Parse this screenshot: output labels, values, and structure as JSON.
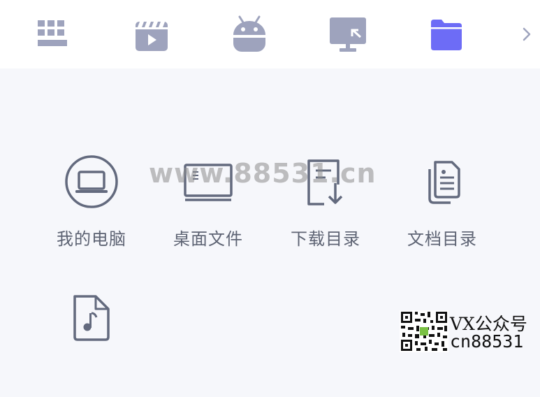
{
  "tabs": [
    {
      "icon": "apps-grid-icon",
      "active": false
    },
    {
      "icon": "video-clapper-icon",
      "active": false
    },
    {
      "icon": "android-icon",
      "active": false
    },
    {
      "icon": "screen-cast-icon",
      "active": false
    },
    {
      "icon": "folder-icon",
      "active": true
    }
  ],
  "more_icon": "chevron-right-icon",
  "colors": {
    "inactive_icon": "#9ea3bd",
    "active_icon": "#6d6cf6",
    "label": "#5d6373",
    "item_icon": "#636a7e",
    "background": "#f6f7fb"
  },
  "items": [
    {
      "label": "我的电脑",
      "icon": "laptop-icon"
    },
    {
      "label": "桌面文件",
      "icon": "desktop-monitor-icon"
    },
    {
      "label": "下载目录",
      "icon": "download-document-icon"
    },
    {
      "label": "文档目录",
      "icon": "documents-icon"
    },
    {
      "label": "",
      "icon": "music-file-icon"
    }
  ],
  "watermark": "www.88531.cn",
  "badge": {
    "line1": "VX公众号",
    "line2": "cn88531"
  }
}
